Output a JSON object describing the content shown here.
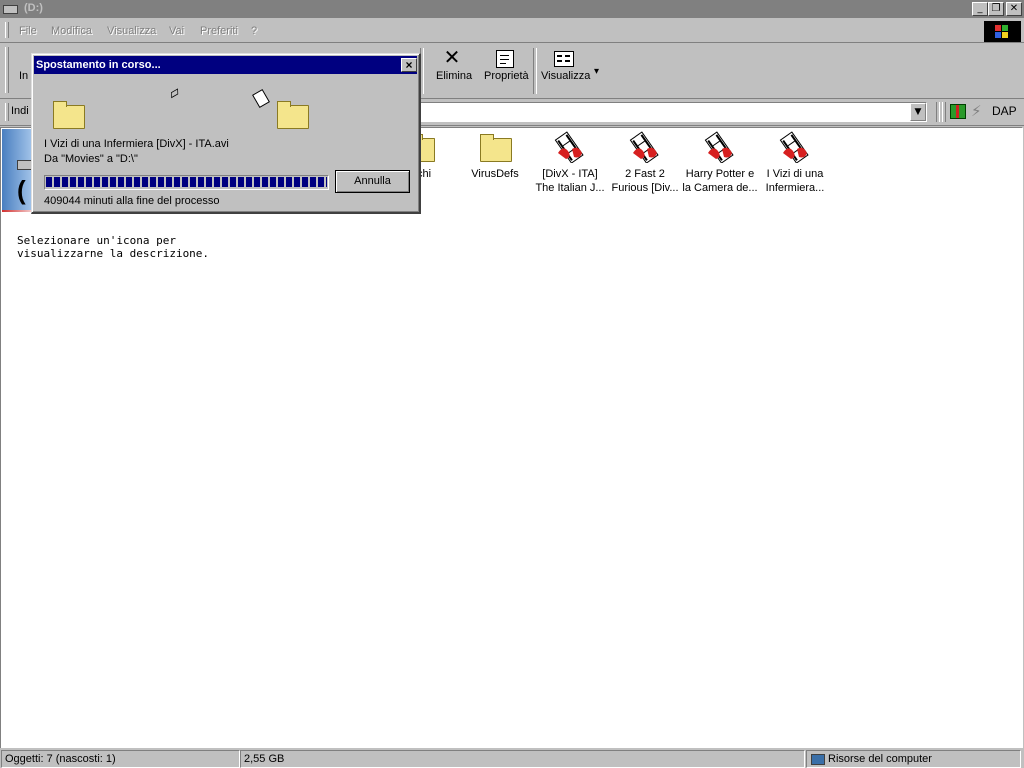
{
  "window": {
    "title": "(D:)"
  },
  "menu": {
    "items": [
      "File",
      "Modifica",
      "Visualizza",
      "Vai",
      "Preferiti",
      "?"
    ]
  },
  "toolbar": {
    "partial_left_label": "In",
    "delete_label": "Elimina",
    "properties_label": "Proprietà",
    "view_label": "Visualizza",
    "view_dropdown": "▾"
  },
  "address": {
    "partial_label": "Indi",
    "links_label": "DAP"
  },
  "left_panel": {
    "partial_big_char": "(",
    "description": "Selezionare un'icona per visualizzarne la descrizione."
  },
  "files": [
    {
      "name_partial": "chi",
      "type": "folder"
    },
    {
      "name": "VirusDefs",
      "type": "folder"
    },
    {
      "name_line1": "[DivX - ITA]",
      "name_line2": "The Italian J...",
      "type": "video"
    },
    {
      "name_line1": "2 Fast 2",
      "name_line2": "Furious [Div...",
      "type": "video"
    },
    {
      "name_line1": "Harry Potter e",
      "name_line2": "la Camera de...",
      "type": "video"
    },
    {
      "name_line1": "I Vizi di una",
      "name_line2": "Infermiera...",
      "type": "video"
    }
  ],
  "dialog": {
    "title": "Spostamento in corso...",
    "close": "×",
    "filename": "I Vizi di una Infermiera [DivX] - ITA.avi",
    "from_to": "Da \"Movies\" a \"D:\\\"",
    "cancel_label": "Annulla",
    "time_remaining": "409044 minuti alla fine del processo",
    "progress": 1.0
  },
  "statusbar": {
    "objects": "Oggetti: 7 (nascosti: 1)",
    "size": "2,55 GB",
    "location": "Risorse del computer"
  },
  "colors": {
    "title_active": "#000080",
    "desktop_face": "#c0c0c0",
    "progress": "#000080"
  }
}
